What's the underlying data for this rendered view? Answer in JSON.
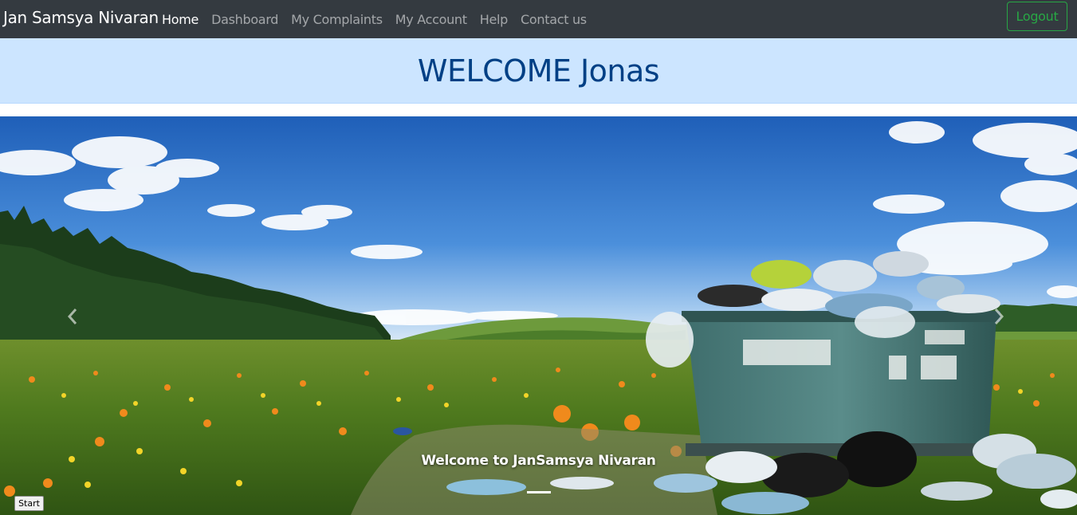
{
  "navbar": {
    "brand": "Jan Samsya Nivaran",
    "links": [
      {
        "label": "Home",
        "active": true
      },
      {
        "label": "Dashboard",
        "active": false
      },
      {
        "label": "My Complaints",
        "active": false
      },
      {
        "label": "My Account",
        "active": false
      },
      {
        "label": "Help",
        "active": false
      },
      {
        "label": "Contact us",
        "active": false
      }
    ],
    "logout_label": "Logout"
  },
  "welcome": {
    "heading": "WELCOME Jonas"
  },
  "carousel": {
    "caption": "Welcome to JanSamsya Nivaran",
    "prev_icon": "chevron-left-icon",
    "next_icon": "chevron-right-icon",
    "slide_count": 1
  },
  "start_button": {
    "label": "Start"
  },
  "colors": {
    "navbar_bg": "#343a40",
    "welcome_bg": "#cce5ff",
    "welcome_text": "#004085",
    "logout_accent": "#28a745"
  }
}
